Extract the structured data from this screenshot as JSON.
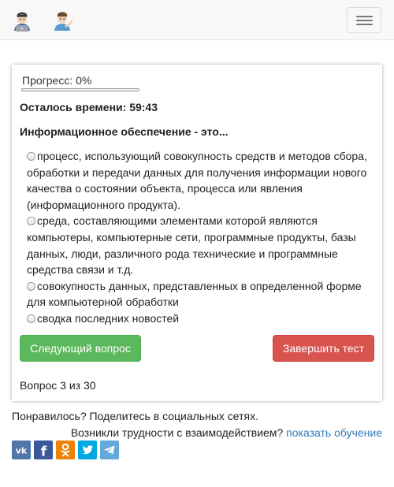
{
  "navbar": {
    "avatars": [
      "man-technologist-icon",
      "man-tipping-hand-icon"
    ],
    "menu_icon": "hamburger-icon"
  },
  "quiz": {
    "progress_label": "Прогресс: 0%",
    "progress_fraction": 0,
    "timer_text": "Осталось времени: 59:43",
    "question_text": "Информационное обеспечение - это...",
    "answers": [
      "процесс, использующий совокупность средств и методов сбора, обработки и передачи данных для получения информации нового качества о состоянии объекта, процесса или явления (информационного продукта).",
      "среда, составляющими элементами которой являются компьютеры, компьютерные сети, программные продукты, базы данных, люди, различного рода технические и программные средства связи и т.д.",
      "совокупность данных, представленных в определенной форме для компьютерной обработки",
      "сводка последних новостей"
    ],
    "next_button": "Следующий вопрос",
    "finish_button": "Завершить тест",
    "counter_text": "Вопрос 3 из 30"
  },
  "footer": {
    "share_text": "Понравилось? Поделитесь в социальных сетях.",
    "help_text": "Возникли трудности с взаимодействием?",
    "help_link": "показать обучение",
    "social": [
      "vk-icon",
      "facebook-icon",
      "odnoklassniki-icon",
      "twitter-icon",
      "telegram-icon"
    ]
  },
  "colors": {
    "next_button": "#5cb85c",
    "finish_button": "#d9534f",
    "link": "#337ab7",
    "vk": "#5077a7",
    "facebook": "#3b5998",
    "odnoklassniki": "#ee8208",
    "twitter": "#00a9e0",
    "telegram": "#64a9dc"
  }
}
